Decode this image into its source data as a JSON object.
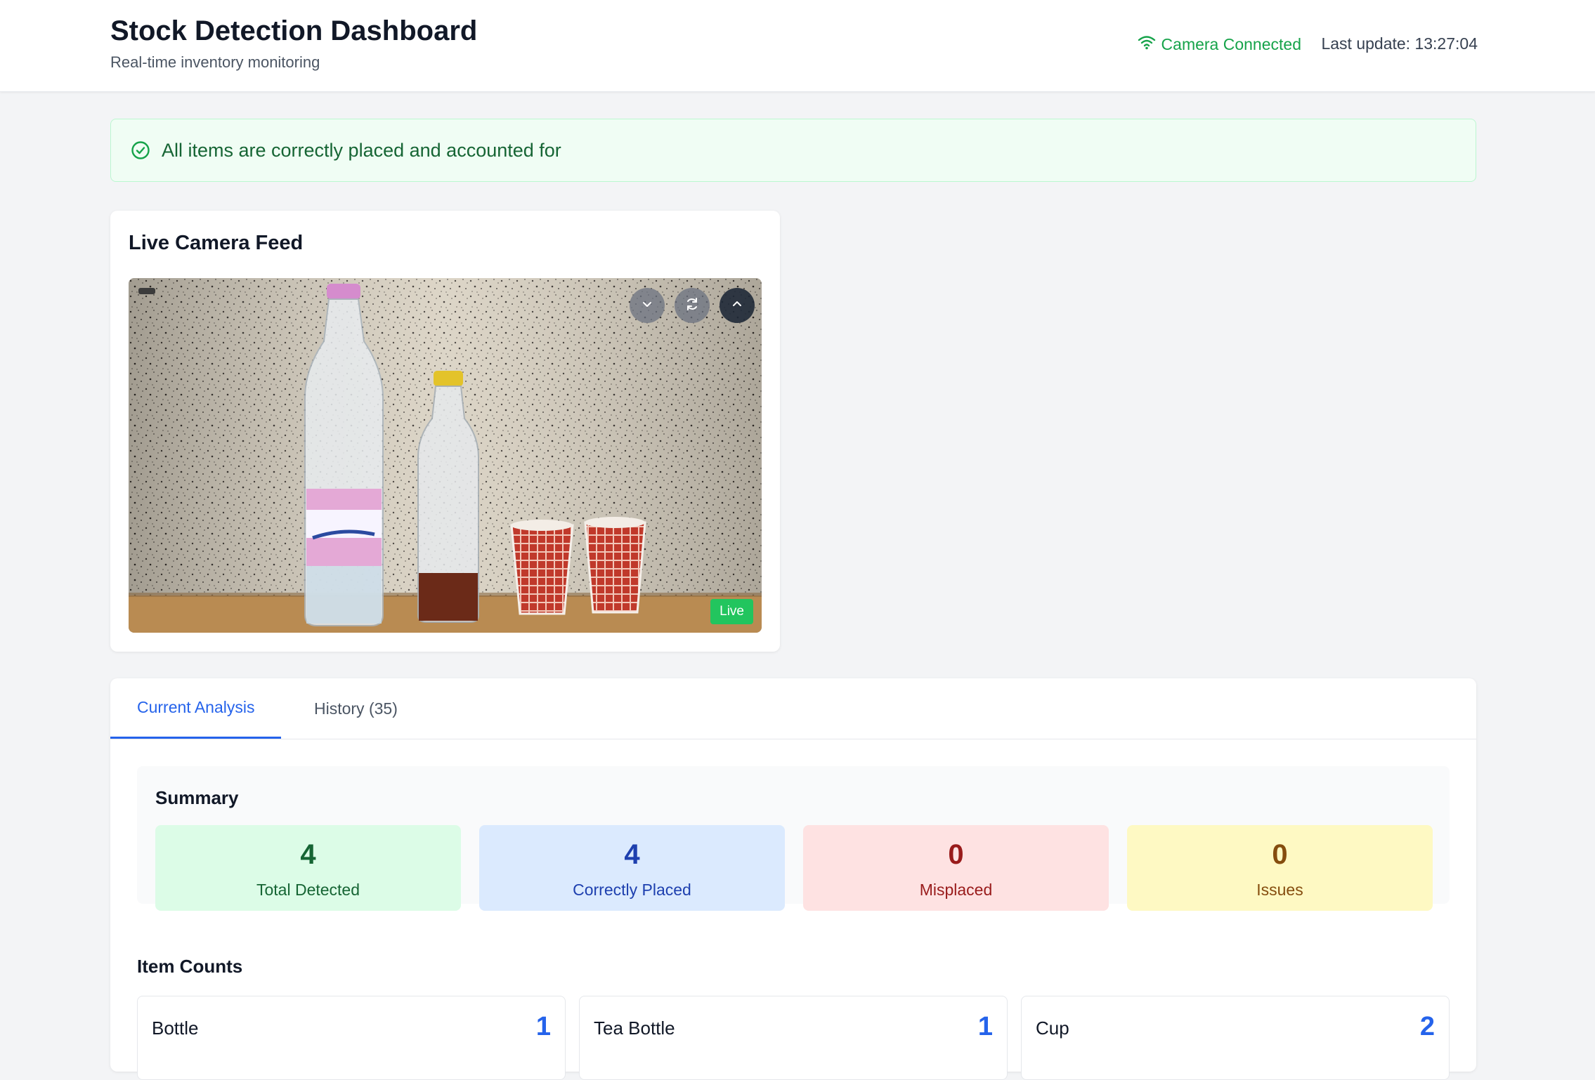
{
  "header": {
    "title": "Stock Detection Dashboard",
    "subtitle": "Real-time inventory monitoring",
    "connection_status": "Camera Connected",
    "last_update": "Last update: 13:27:04"
  },
  "alert": {
    "message": "All items are correctly placed and accounted for",
    "icon": "check-circle-icon"
  },
  "camera": {
    "title": "Live Camera Feed",
    "badge": "Live",
    "controls": [
      "chevron-down-icon",
      "refresh-icon",
      "chevron-up-icon"
    ]
  },
  "tabs": [
    {
      "label": "Current Analysis",
      "active": true
    },
    {
      "label": "History (35)",
      "active": false
    }
  ],
  "summary": {
    "title": "Summary",
    "stats": [
      {
        "value": "4",
        "label": "Total Detected",
        "bg": "#dcfce7",
        "color": "#166534"
      },
      {
        "value": "4",
        "label": "Correctly Placed",
        "bg": "#dbeafe",
        "color": "#1e40af"
      },
      {
        "value": "0",
        "label": "Misplaced",
        "bg": "#fee2e2",
        "color": "#991b1b"
      },
      {
        "value": "0",
        "label": "Issues",
        "bg": "#fef9c3",
        "color": "#854d0e"
      }
    ]
  },
  "item_counts": {
    "title": "Item Counts",
    "items": [
      {
        "name": "Bottle",
        "count": "1"
      },
      {
        "name": "Tea Bottle",
        "count": "1"
      },
      {
        "name": "Cup",
        "count": "2"
      }
    ]
  },
  "colors": {
    "accent": "#2563eb",
    "success": "#16a34a"
  }
}
